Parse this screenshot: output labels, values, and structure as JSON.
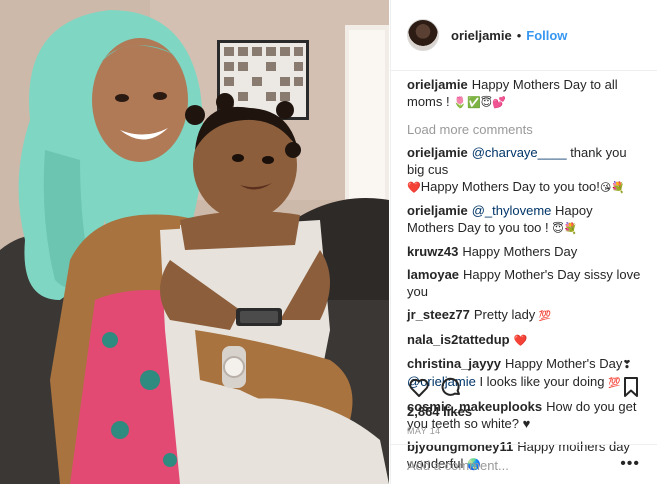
{
  "post": {
    "username": "orieljamie",
    "follow_label": "Follow",
    "separator": "•",
    "caption_user": "orieljamie",
    "caption_text": "Happy Mothers Day to all moms !",
    "caption_emoji": "🌷✅😇💕",
    "load_more": "Load more comments",
    "likes": "2,864 likes",
    "date": "MAY 14",
    "add_comment_placeholder": "Add a comment...",
    "more_label": "•••"
  },
  "comments": [
    {
      "user": "orieljamie",
      "mention": "@charvaye____",
      "text": " thank you big cus",
      "line2_emoji": "❤️",
      "line2": "Happy Mothers Day to you too!",
      "tail_emoji": "😘💐"
    },
    {
      "user": "orieljamie",
      "mention": "@_thyloveme",
      "text": " Hapoy Mothers Day to you too ! ",
      "tail_emoji": "😇💐"
    },
    {
      "user": "kruwz43",
      "text": "Happy Mothers Day"
    },
    {
      "user": "lamoyae",
      "text": "Happy Mother's Day sissy love you"
    },
    {
      "user": "jr_steez77",
      "text": "Pretty lady ",
      "tail_emoji": "💯"
    },
    {
      "user": "nala_is2tattedup",
      "tail_emoji": "❤️"
    },
    {
      "user": "christina_jayyy",
      "text": "Happy Mother's Day",
      "mid_emoji": "❣",
      "mention": "@orieljamie",
      "text2": " I looks like your doing ",
      "tail_emoji": "💯"
    },
    {
      "user": "cosmic_makeuplooks",
      "text": "How do you get you teeth so white? ♥"
    },
    {
      "user": "bjyoungmoney11",
      "text": "Happy mothers day wonderful ",
      "tail_emoji": "🌏"
    }
  ],
  "icons": {
    "like": "heart-outline-icon",
    "comment": "comment-bubble-icon",
    "save": "bookmark-icon",
    "more": "ellipsis-icon"
  },
  "colors": {
    "link": "#3897f0",
    "mention": "#003569",
    "hair": "#7fd6c2",
    "muted": "#999999"
  }
}
